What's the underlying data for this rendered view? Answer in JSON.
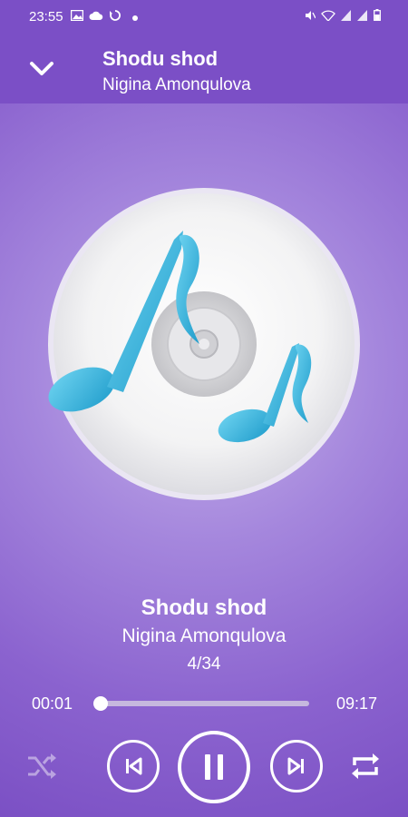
{
  "status_bar": {
    "time": "23:55",
    "notification_icons": [
      "image-icon",
      "cloud-icon",
      "sync-icon",
      "dot-icon"
    ],
    "system_icons": [
      "mute-icon",
      "wifi-icon",
      "signal-icon",
      "signal-icon",
      "battery-icon"
    ]
  },
  "header": {
    "collapse_icon": "chevron-down-icon",
    "title": "Shodu shod",
    "subtitle": "Nigina Amonqulova"
  },
  "now_playing": {
    "title": "Shodu shod",
    "artist": "Nigina Amonqulova",
    "track_position": "4/34",
    "elapsed": "00:01",
    "duration": "09:17",
    "progress_fraction": 0.002
  },
  "controls": {
    "shuffle_icon": "shuffle-icon",
    "previous_icon": "skip-previous-icon",
    "play_pause_icon": "pause-icon",
    "next_icon": "skip-next-icon",
    "repeat_icon": "repeat-icon"
  },
  "colors": {
    "accent": "#7b4fc6",
    "note_blue": "#2fb3dc"
  }
}
